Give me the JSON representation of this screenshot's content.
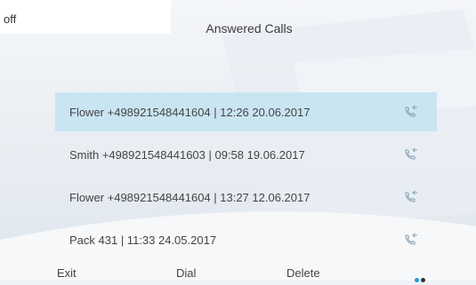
{
  "status": {
    "text": "off"
  },
  "header": {
    "title": "Answered Calls"
  },
  "calls": [
    {
      "label": "Flower +498921548441604   | 12:26 20.06.2017",
      "selected": true
    },
    {
      "label": "Smith +498921548441603   | 09:58 19.06.2017",
      "selected": false
    },
    {
      "label": "Flower +498921548441604   | 13:27 12.06.2017",
      "selected": false
    },
    {
      "label": "Pack 431   | 11:33 24.05.2017",
      "selected": false
    }
  ],
  "softkeys": {
    "exit": "Exit",
    "dial": "Dial",
    "delete": "Delete"
  },
  "colors": {
    "selected_row": "#c9e5f2",
    "call_icon": "#8aa3b5",
    "page_dot_active": "#1aa0d6",
    "page_dot_inactive": "#333333"
  },
  "icons": {
    "call_entry": "answered-call-icon",
    "more": "page-dots-icon"
  }
}
